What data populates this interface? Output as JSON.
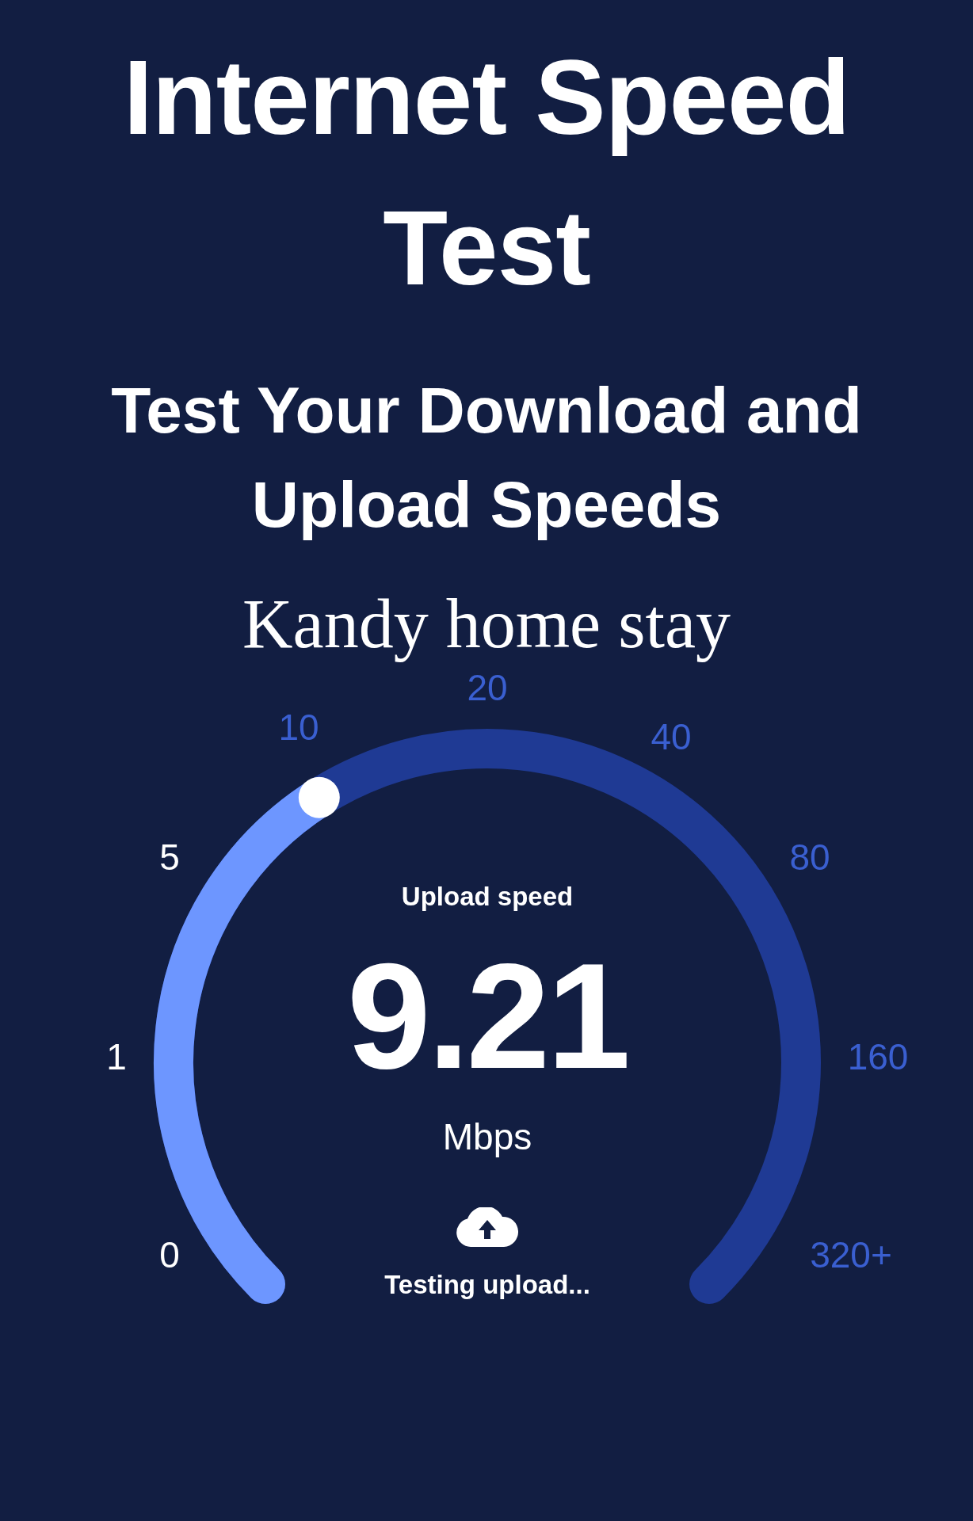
{
  "title": "Internet Speed Test",
  "subtitle": "Test Your Download and Upload Speeds",
  "location": "Kandy home stay",
  "gauge": {
    "scale_labels": [
      {
        "text": "0",
        "reached": true
      },
      {
        "text": "1",
        "reached": true
      },
      {
        "text": "5",
        "reached": true
      },
      {
        "text": "10",
        "reached": false
      },
      {
        "text": "20",
        "reached": false
      },
      {
        "text": "40",
        "reached": false
      },
      {
        "text": "80",
        "reached": false
      },
      {
        "text": "160",
        "reached": false
      },
      {
        "text": "320+",
        "reached": false
      }
    ],
    "caption": "Upload speed",
    "value": "9.21",
    "unit": "Mbps",
    "status": "Testing upload..."
  }
}
